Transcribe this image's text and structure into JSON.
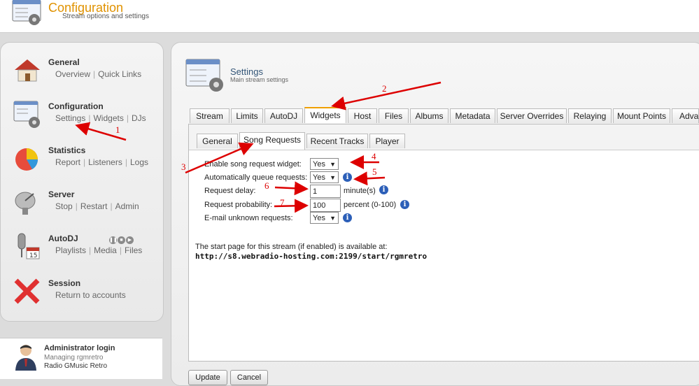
{
  "header": {
    "title": "Configuration",
    "subtitle": "Stream options and settings"
  },
  "sidebar": {
    "general": {
      "title": "General",
      "links": [
        "Overview",
        "Quick Links"
      ]
    },
    "configuration": {
      "title": "Configuration",
      "links": [
        "Settings",
        "Widgets",
        "DJs"
      ]
    },
    "statistics": {
      "title": "Statistics",
      "links": [
        "Report",
        "Listeners",
        "Logs"
      ]
    },
    "server": {
      "title": "Server",
      "links": [
        "Stop",
        "Restart",
        "Admin"
      ]
    },
    "autodj": {
      "title": "AutoDJ",
      "links": [
        "Playlists",
        "Media",
        "Files"
      ]
    },
    "session": {
      "title": "Session",
      "links": [
        "Return to accounts"
      ]
    }
  },
  "admin": {
    "name": "Administrator login",
    "managing": "Managing rgmretro",
    "station": "Radio GMusic Retro"
  },
  "main": {
    "title": "Settings",
    "subtitle": "Main stream settings"
  },
  "tabs": [
    "Stream",
    "Limits",
    "AutoDJ",
    "Widgets",
    "Host",
    "Files",
    "Albums",
    "Metadata",
    "Server Overrides",
    "Relaying",
    "Mount Points",
    "Advar"
  ],
  "subtabs": [
    "General",
    "Song Requests",
    "Recent Tracks",
    "Player"
  ],
  "form": {
    "enable_label": "Enable song request widget:",
    "enable_value": "Yes",
    "autoqueue_label": "Automatically queue requests:",
    "autoqueue_value": "Yes",
    "delay_label": "Request delay:",
    "delay_value": "1",
    "delay_unit": "minute(s)",
    "prob_label": "Request probability:",
    "prob_value": "100",
    "prob_unit": "percent (0-100)",
    "email_label": "E-mail unknown requests:",
    "email_value": "Yes"
  },
  "notice": "The start page for this stream (if enabled) is available at:",
  "start_url": "http://s8.webradio-hosting.com:2199/start/rgmretro",
  "buttons": {
    "update": "Update",
    "cancel": "Cancel"
  },
  "annotations": [
    "1",
    "2",
    "3",
    "4",
    "5",
    "6",
    "7"
  ],
  "colors": {
    "accent": "#e09200",
    "annotation": "#dd0000",
    "info": "#2c5fb8"
  }
}
